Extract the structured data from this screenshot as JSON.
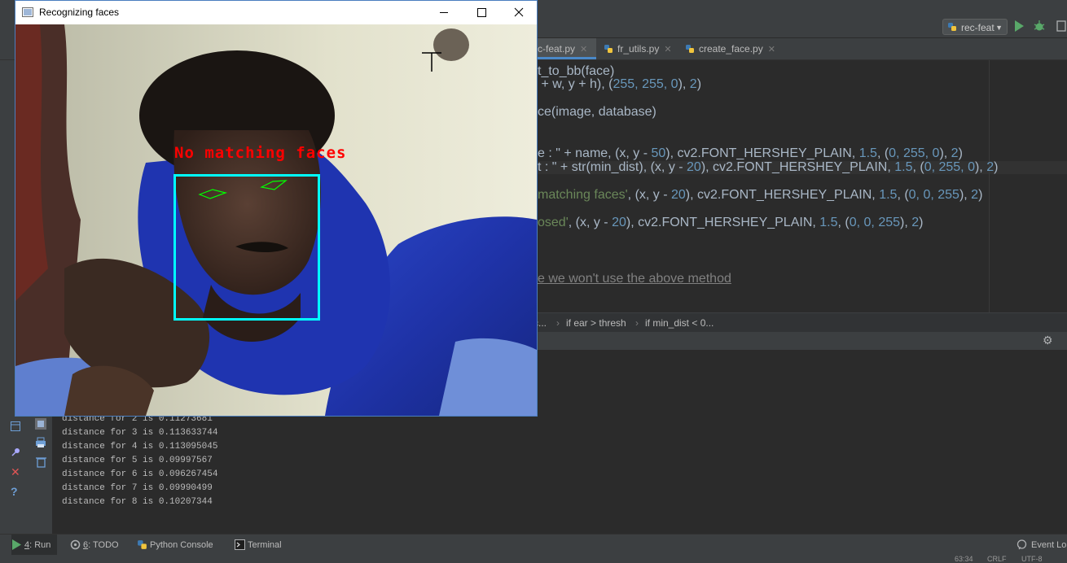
{
  "ide": {
    "run_config": "rec-feat",
    "tabs": [
      {
        "label": "c-feat.py",
        "active": true
      },
      {
        "label": "fr_utils.py",
        "active": false
      },
      {
        "label": "create_face.py",
        "active": false
      }
    ],
    "code_lines": {
      "l1": "t_to_bb(face)",
      "l2a": " + w, y + h), (",
      "l2b": "255, 255, 0",
      "l2c": "), ",
      "l2d": "2",
      "l2e": ")",
      "l3": "ce(image, database)",
      "l4a": "e : \" + name, (x, y - ",
      "l4b": "50",
      "l4c": "), cv2.FONT_HERSHEY_PLAIN, ",
      "l4d": "1.5",
      "l4e": ", (",
      "l4f": "0, 255, 0",
      "l4g": "), ",
      "l4h": "2",
      "l4i": ")",
      "l5a": "t : \" + str(min_dist), (x, y - ",
      "l5b": "20",
      "l5c": "), cv2.FONT_HERSHEY_PLAIN, ",
      "l5d": "1.5",
      "l5e": ", (",
      "l5f": "0, 255, 0",
      "l5g": "), ",
      "l5h": "2",
      "l5i": ")",
      "l6a": "matching faces'",
      "l6b": ", (x, y - ",
      "l6c": "20",
      "l6d": "), cv2.FONT_HERSHEY_PLAIN, ",
      "l6e": "1.5",
      "l6f": ", (",
      "l6g": "0, 0, 255",
      "l6h": "), ",
      "l6i": "2",
      "l6j": ")",
      "l7a": "osed'",
      "l7b": ", (x, y - ",
      "l7c": "20",
      "l7d": "), cv2.FONT_HERSHEY_PLAIN, ",
      "l7e": "1.5",
      "l7f": ", (",
      "l7g": "0, 0, 255",
      "l7h": "), ",
      "l7i": "2",
      "l7j": ")",
      "l8": "e we won't use the above method"
    },
    "breadcrumbs": [
      "c...",
      "if ear > thresh",
      "if min_dist < 0..."
    ],
    "breadcrumb_sep": "›",
    "console_lines": [
      "distance for 2 is 0.11273681",
      "distance for 3 is 0.113633744",
      "distance for 4 is 0.113095045",
      "distance for 5 is 0.09997567",
      "distance for 6 is 0.096267454",
      "distance for 7 is 0.09990499",
      "distance for 8 is 0.10207344"
    ],
    "bottom_tabs": {
      "run_num": "4",
      "run_label": ": Run",
      "todo_num": "6",
      "todo_label": ": TODO",
      "python_console": "Python Console",
      "terminal": "Terminal"
    },
    "event_log": "Event Lo",
    "status": {
      "position": "63:34",
      "line_sep": "CRLF",
      "encoding": "UTF-8"
    }
  },
  "cv_window": {
    "title": "Recognizing faces",
    "overlay_text": "No matching faces"
  },
  "colors": {
    "accent": "#4a88c7",
    "face_box": "#00ffff",
    "overlay_text": "#ff0000",
    "eye_contour": "#00ff00"
  }
}
